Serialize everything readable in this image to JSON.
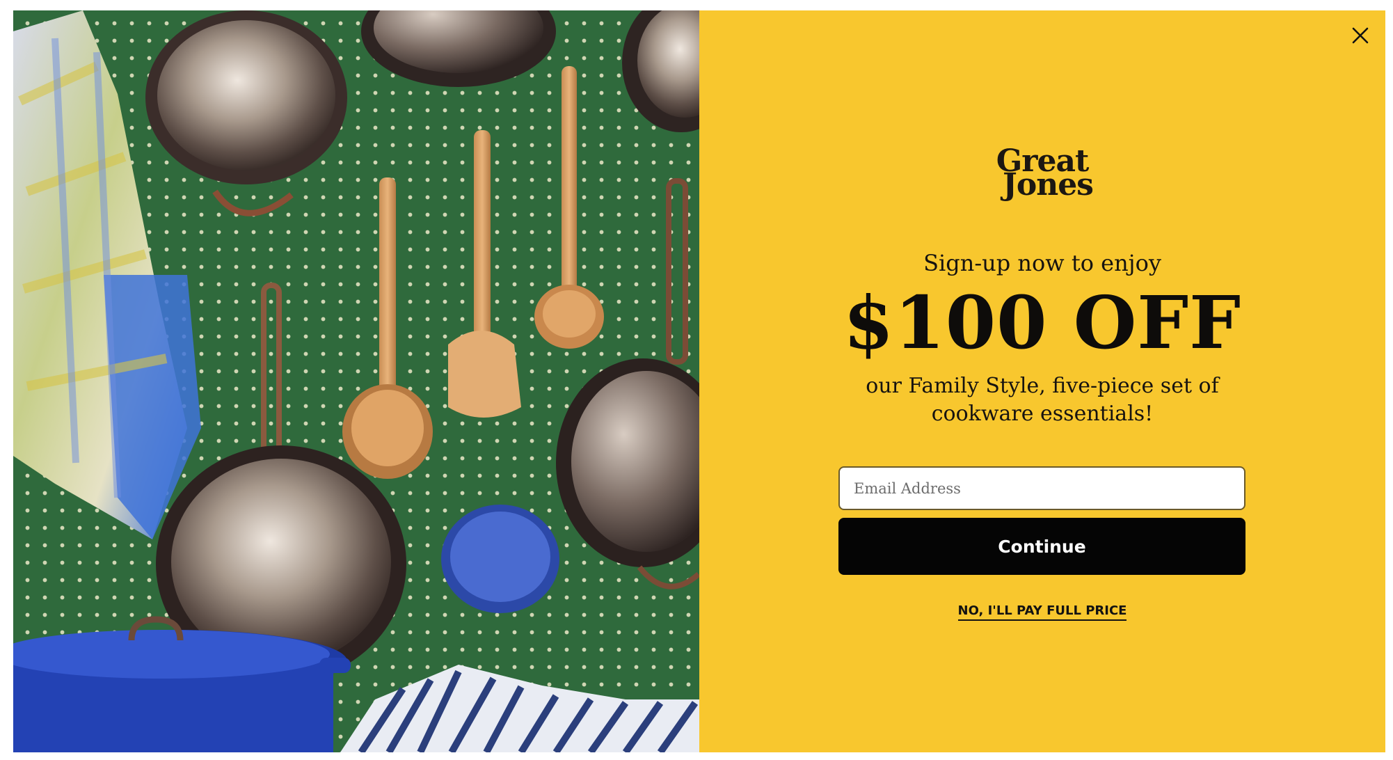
{
  "popup": {
    "photo": {
      "description_icon": "product-photo"
    },
    "close_icon": "close-icon",
    "logo": {
      "line1": "Great",
      "line2": "Jones"
    },
    "signup_text": "Sign-up now to enjoy",
    "headline": "$100 OFF",
    "subtext": "our Family Style, five-piece set of cookware essentials!",
    "email": {
      "placeholder": "Email Address",
      "value": ""
    },
    "continue_label": "Continue",
    "decline_label": "NO, I'LL PAY FULL PRICE"
  },
  "colors": {
    "accent_yellow": "#f8c72e",
    "pegboard_green": "#2f6a3c",
    "button_black": "#050505"
  }
}
